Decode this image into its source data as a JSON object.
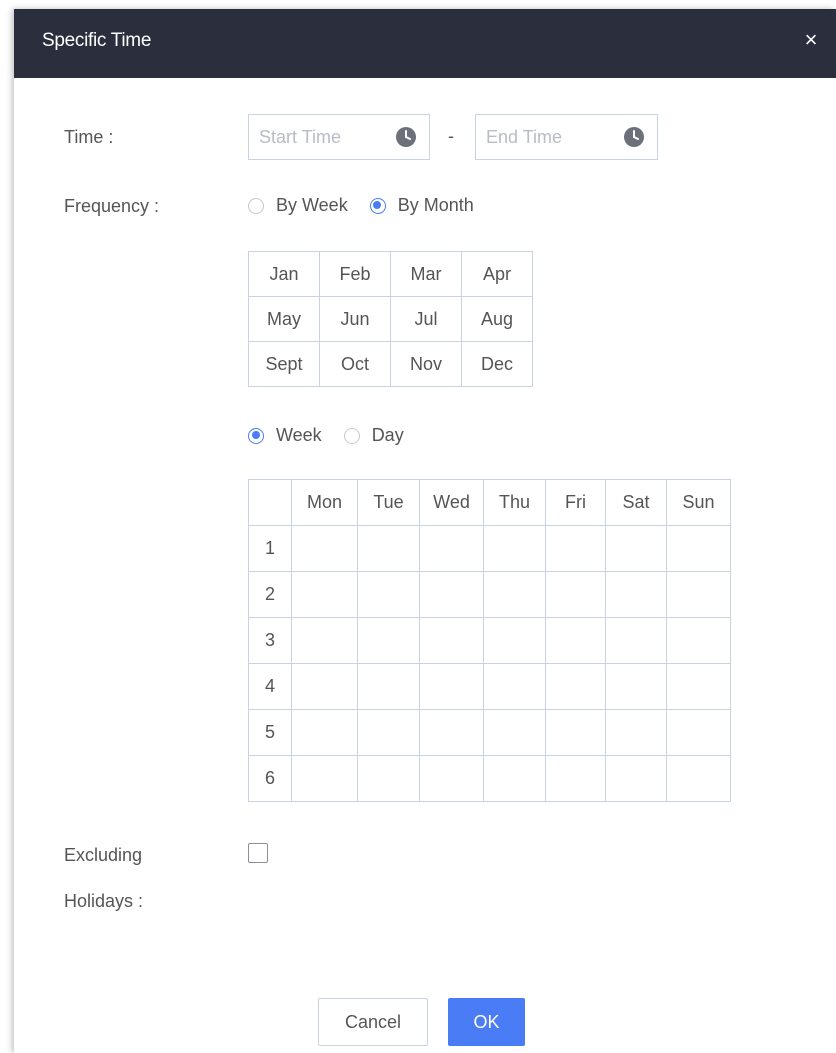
{
  "dialog": {
    "title": "Specific Time",
    "close_glyph": "×"
  },
  "time": {
    "label": "Time :",
    "start_placeholder": "Start Time",
    "separator": "-",
    "end_placeholder": "End Time",
    "icon": "clock-icon"
  },
  "frequency": {
    "label": "Frequency :",
    "options": [
      {
        "label": "By Week",
        "selected": false
      },
      {
        "label": "By Month",
        "selected": true
      }
    ]
  },
  "months": [
    [
      "Jan",
      "Feb",
      "Mar",
      "Apr"
    ],
    [
      "May",
      "Jun",
      "Jul",
      "Aug"
    ],
    [
      "Sept",
      "Oct",
      "Nov",
      "Dec"
    ]
  ],
  "mode": {
    "options": [
      {
        "label": "Week",
        "selected": true
      },
      {
        "label": "Day",
        "selected": false
      }
    ]
  },
  "week_table": {
    "columns": [
      "Mon",
      "Tue",
      "Wed",
      "Thu",
      "Fri",
      "Sat",
      "Sun"
    ],
    "rows": [
      "1",
      "2",
      "3",
      "4",
      "5",
      "6"
    ]
  },
  "excluding": {
    "label_line1": "Excluding",
    "label_line2": "Holidays :",
    "checked": false
  },
  "buttons": {
    "cancel": "Cancel",
    "ok": "OK"
  },
  "colors": {
    "titlebar": "#2b2f3d",
    "accent": "#4a7cf5",
    "border": "#c9d2e3"
  }
}
